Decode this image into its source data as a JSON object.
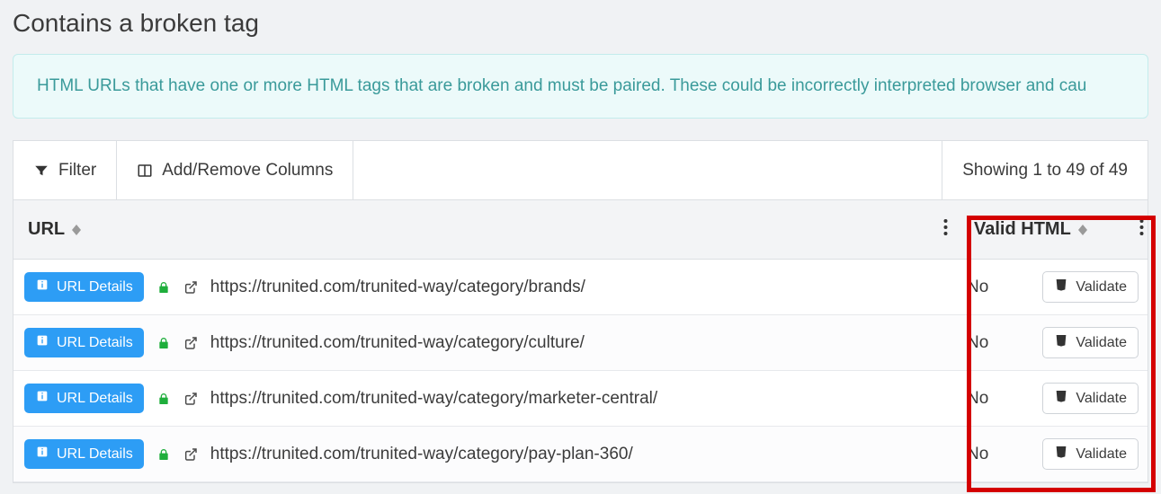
{
  "header": {
    "title": "Contains a broken tag",
    "info_text": "HTML URLs that have one or more HTML tags that are broken and must be paired. These could be incorrectly interpreted browser and cau"
  },
  "toolbar": {
    "filter_label": "Filter",
    "columns_label": "Add/Remove Columns",
    "showing_text": "Showing 1 to 49 of 49"
  },
  "columns": {
    "url": "URL",
    "valid_html": "Valid HTML"
  },
  "buttons": {
    "url_details": "URL Details",
    "validate": "Validate"
  },
  "rows": [
    {
      "url": "https://trunited.com/trunited-way/category/brands/",
      "valid_html": "No"
    },
    {
      "url": "https://trunited.com/trunited-way/category/culture/",
      "valid_html": "No"
    },
    {
      "url": "https://trunited.com/trunited-way/category/marketer-central/",
      "valid_html": "No"
    },
    {
      "url": "https://trunited.com/trunited-way/category/pay-plan-360/",
      "valid_html": "No"
    }
  ]
}
